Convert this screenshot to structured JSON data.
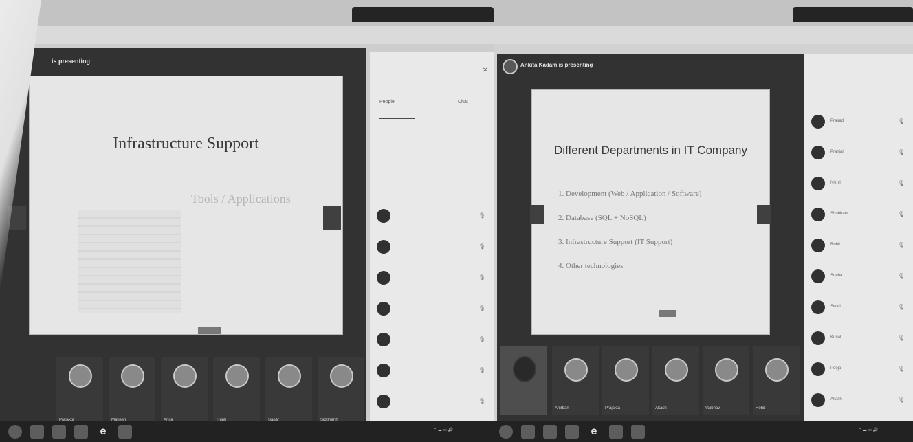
{
  "left": {
    "presenter_label": "is presenting",
    "slide_title": "Infrastructure Support",
    "slide_right_heading": "Tools / Applications",
    "side_tabs": {
      "people": "People",
      "chat": "Chat"
    },
    "participants_names": [
      "Prajakta",
      "Mahesh",
      "Anita",
      "Trupti",
      "Sagar",
      "Siddharth"
    ]
  },
  "right": {
    "presenter_label": "Ankita Kadam is presenting",
    "slide_title": "Different Departments in IT Company",
    "bullets": [
      "1. Development (Web / Application / Software)",
      "2. Database (SQL + NoSQL)",
      "3. Infrastructure Support (IT Support)",
      "4. Other technologies"
    ],
    "participants_names": [
      "Prasad",
      "Pranjali",
      "Nikhil",
      "Shubham",
      "Rohit",
      "Sneha",
      "Swati",
      "Kunal",
      "Pooja",
      "Akash"
    ],
    "tiles": [
      "Anirban",
      "Prajakta",
      "Akash",
      "Vaibhav",
      "Rohit"
    ]
  },
  "colors": {
    "bg": "#d4d4d4",
    "meeting": "#2b2b2b",
    "taskbar": "#1a1a1a"
  }
}
